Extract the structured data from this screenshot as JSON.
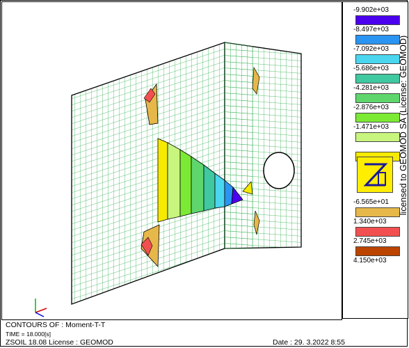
{
  "legend": {
    "entries": [
      {
        "label": "-9.902e+03",
        "color": "#4b00ee"
      },
      {
        "label": "-8.497e+03",
        "color": "#2a94f2"
      },
      {
        "label": "-7.092e+03",
        "color": "#4ad6ee"
      },
      {
        "label": "-5.686e+03",
        "color": "#40c8a0"
      },
      {
        "label": "-4.281e+03",
        "color": "#5ed66c"
      },
      {
        "label": "-2.876e+03",
        "color": "#7cea34"
      },
      {
        "label": "-1.471e+03",
        "color": "#c8f57e"
      },
      {
        "label": "",
        "color": "#f5ea00"
      },
      {
        "label": "-6.565e+01",
        "color": "#e6b84a"
      },
      {
        "label": "1.340e+03",
        "color": "#f25050"
      },
      {
        "label": "2.745e+03",
        "color": "#bb4400"
      },
      {
        "label": "4.150e+03",
        "color": ""
      }
    ],
    "license_text": "licensed to GEOMOD SA (License: GEOMOD)"
  },
  "footer": {
    "contours": "CONTOURS OF : Moment-T-T",
    "time": "TIME = 18.000[s]",
    "software": "ZSOIL 18.08   License :  GEOMOD",
    "date": "Date : 29. 3.2022   8:55"
  },
  "colors": {
    "mesh": "#22aa44",
    "outline": "#000000"
  }
}
